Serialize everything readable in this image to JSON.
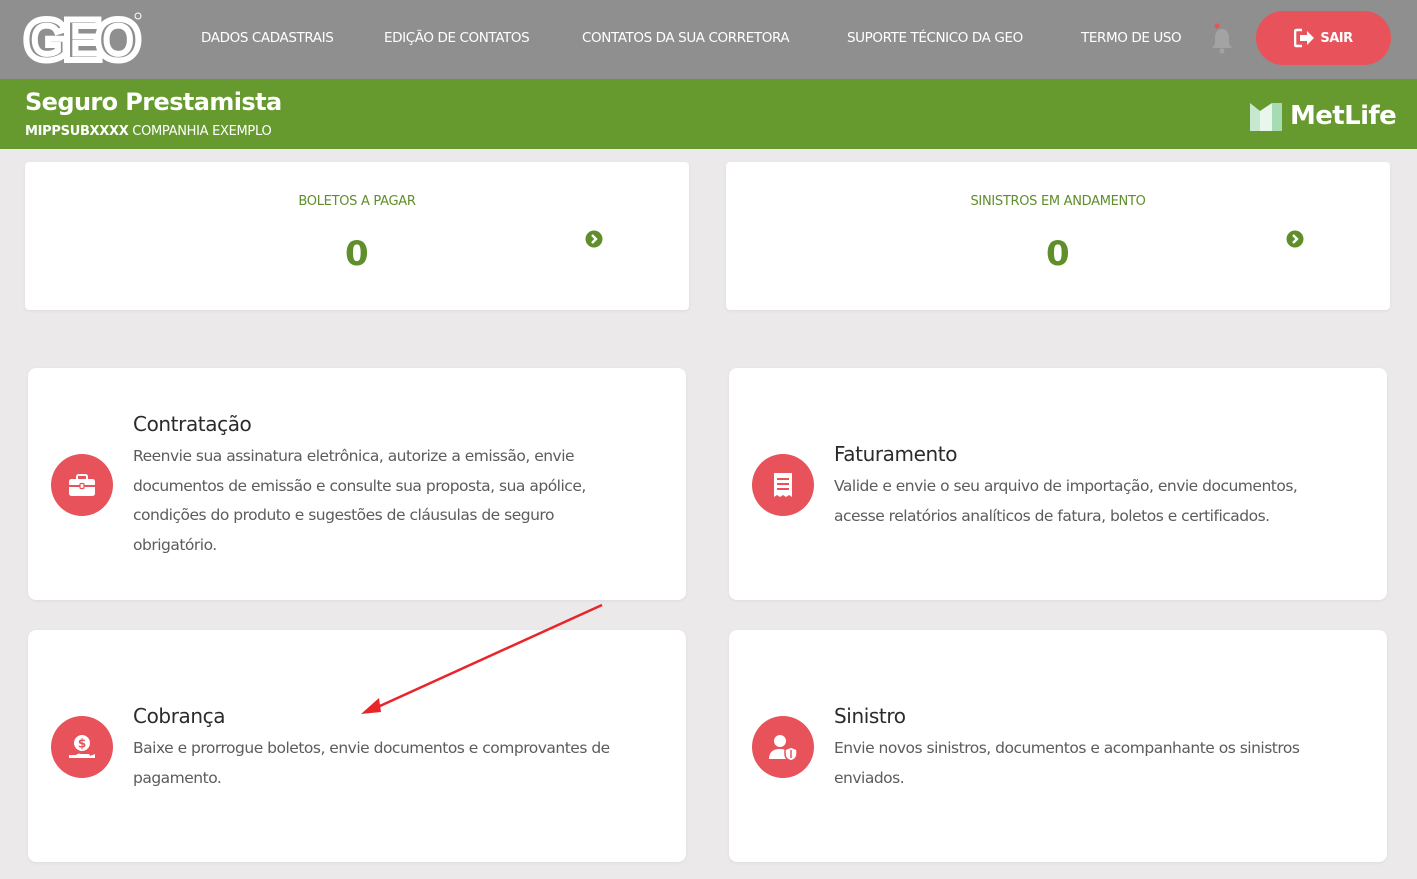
{
  "header": {
    "logo_text": "GEO",
    "nav": [
      "DADOS CADASTRAIS",
      "EDIÇÃO DE CONTATOS",
      "CONTATOS DA SUA CORRETORA",
      "SUPORTE TÉCNICO DA GEO",
      "TERMO DE USO"
    ],
    "logout_label": "SAIR"
  },
  "banner": {
    "title": "Seguro Prestamista",
    "code": "MIPPSUBXXXX",
    "company": "COMPANHIA EXEMPLO",
    "insurer": "MetLife"
  },
  "stats": [
    {
      "label": "BOLETOS A PAGAR",
      "value": "0"
    },
    {
      "label": "SINISTROS EM ANDAMENTO",
      "value": "0"
    }
  ],
  "features": [
    {
      "title": "Contratação",
      "description": "Reenvie sua assinatura eletrônica, autorize a emissão, envie documentos de emissão e consulte sua proposta, sua apólice, condições do produto e sugestões de cláusulas de seguro obrigatório.",
      "icon": "briefcase-icon"
    },
    {
      "title": "Faturamento",
      "description": "Valide e envie o seu arquivo de importação, envie documentos, acesse relatórios analíticos de fatura, boletos e certificados.",
      "icon": "receipt-icon"
    },
    {
      "title": "Cobrança",
      "description": "Baixe e prorrogue boletos, envie documentos e comprovantes de pagamento.",
      "icon": "money-hand-icon"
    },
    {
      "title": "Sinistro",
      "description": "Envie novos sinistros, documentos e acompanhante os sinistros enviados.",
      "icon": "user-shield-icon"
    }
  ],
  "colors": {
    "topbar": "#8f8f8f",
    "banner": "#669a2e",
    "accent_red": "#e8525a",
    "stat_green": "#5f8e2a",
    "annotation_arrow": "#e8262a"
  }
}
